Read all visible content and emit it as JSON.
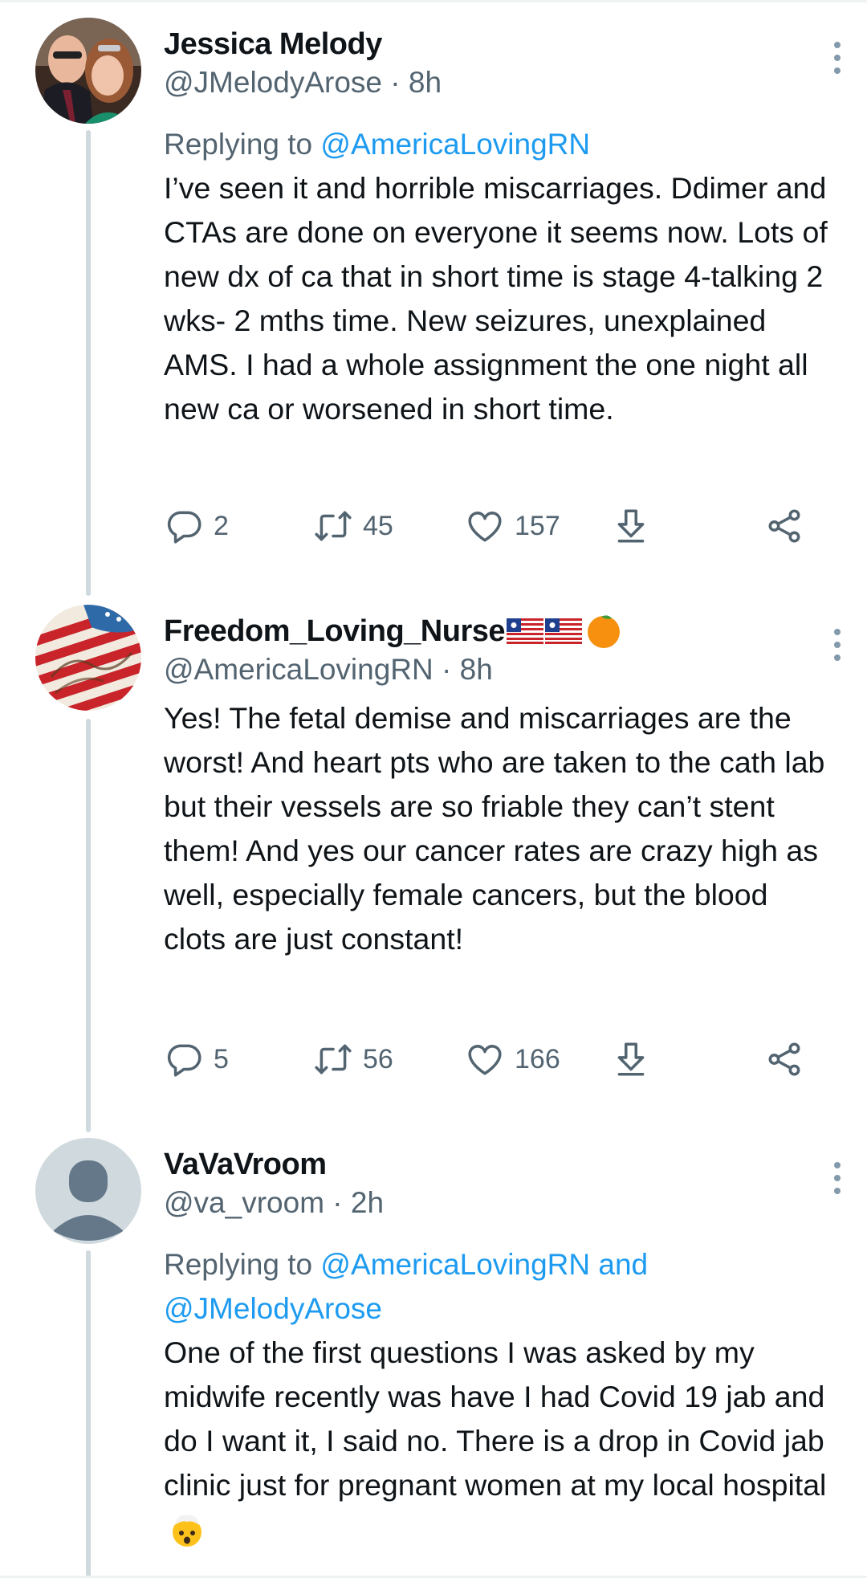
{
  "tweets": [
    {
      "display_name": "Jessica Melody",
      "handle": "@JMelodyArose",
      "time": "8h",
      "separator": "·",
      "reply_prefix": "Replying to ",
      "reply_mentions": "@AmericaLovingRN",
      "text": "I’ve seen it and horrible miscarriages. Ddimer and CTAs are done on everyone it seems now. Lots of new dx of ca that in short time is stage 4-talking 2 wks- 2 mths time. New seizures, unexplained AMS. I had a whole assignment the one night all new ca or worsened in short time.",
      "replies": "2",
      "retweets": "45",
      "likes": "157"
    },
    {
      "display_name": "Freedom_Loving_Nurse",
      "name_emojis": [
        "liberia-flag-emoji",
        "liberia-flag-emoji",
        "orange-emoji"
      ],
      "handle": "@AmericaLovingRN",
      "time": "8h",
      "separator": "·",
      "text": "Yes! The fetal demise and miscarriages are the worst! And heart pts who are taken to the cath lab but their vessels are so friable they can’t stent them! And yes our cancer rates are crazy high as well, especially female cancers, but the blood clots are just constant!",
      "replies": "5",
      "retweets": "56",
      "likes": "166"
    },
    {
      "display_name": "VaVaVroom",
      "handle": "@va_vroom",
      "time": "2h",
      "separator": "·",
      "reply_prefix": "Replying to ",
      "reply_mentions": "@AmericaLovingRN and @JMelodyArose",
      "text": "One of the first questions I was asked by my midwife recently was have I had Covid 19 jab and do I want it, I said no. There is a drop in Covid jab clinic just for pregnant women at my local hospital",
      "text_emoji": "exploding-head-emoji"
    }
  ],
  "colors": {
    "text_primary": "#0f1419",
    "text_secondary": "#536471",
    "link": "#1d9bf0",
    "thread_line": "#cfd9de",
    "icon": "#536471"
  },
  "icons": {
    "reply": "reply-icon",
    "retweet": "retweet-icon",
    "like": "heart-icon",
    "save": "download-arrow-icon",
    "share": "share-icon",
    "more": "more-vertical-icon"
  }
}
